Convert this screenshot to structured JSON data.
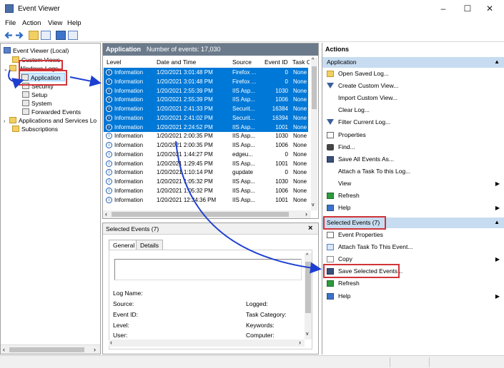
{
  "window": {
    "title": "Event Viewer",
    "minimize": "–",
    "maximize": "☐",
    "close": "✕"
  },
  "menu": [
    "File",
    "Action",
    "View",
    "Help"
  ],
  "tree": {
    "root": "Event Viewer (Local)",
    "custom_views": "Custom Views",
    "windows_logs": "Windows Logs",
    "application": "Application",
    "security": "Security",
    "setup": "Setup",
    "system": "System",
    "forwarded": "Forwarded Events",
    "apps_services": "Applications and Services Lo",
    "subscriptions": "Subscriptions"
  },
  "list": {
    "title": "Application",
    "subtitle": "Number of events: 17,030",
    "columns": [
      "Level",
      "Date and Time",
      "Source",
      "Event ID",
      "Task Ca"
    ],
    "rows": [
      {
        "level": "Information",
        "date": "1/20/2021 3:01:48 PM",
        "source": "Firefox ...",
        "id": "0",
        "task": "None",
        "selected": true
      },
      {
        "level": "Information",
        "date": "1/20/2021 3:01:48 PM",
        "source": "Firefox ...",
        "id": "0",
        "task": "None",
        "selected": true
      },
      {
        "level": "Information",
        "date": "1/20/2021 2:55:39 PM",
        "source": "IIS Asp...",
        "id": "1030",
        "task": "None",
        "selected": true
      },
      {
        "level": "Information",
        "date": "1/20/2021 2:55:39 PM",
        "source": "IIS Asp...",
        "id": "1006",
        "task": "None",
        "selected": true
      },
      {
        "level": "Information",
        "date": "1/20/2021 2:41:33 PM",
        "source": "Securit...",
        "id": "16384",
        "task": "None",
        "selected": true
      },
      {
        "level": "Information",
        "date": "1/20/2021 2:41:02 PM",
        "source": "Securit...",
        "id": "16394",
        "task": "None",
        "selected": true
      },
      {
        "level": "Information",
        "date": "1/20/2021 2:24:52 PM",
        "source": "IIS Asp...",
        "id": "1001",
        "task": "None",
        "selected": true
      },
      {
        "level": "Information",
        "date": "1/20/2021 2:00:35 PM",
        "source": "IIS Asp...",
        "id": "1030",
        "task": "None",
        "selected": false
      },
      {
        "level": "Information",
        "date": "1/20/2021 2:00:35 PM",
        "source": "IIS Asp...",
        "id": "1006",
        "task": "None",
        "selected": false
      },
      {
        "level": "Information",
        "date": "1/20/2021 1:44:27 PM",
        "source": "edgeu...",
        "id": "0",
        "task": "None",
        "selected": false
      },
      {
        "level": "Information",
        "date": "1/20/2021 1:29:45 PM",
        "source": "IIS Asp...",
        "id": "1001",
        "task": "None",
        "selected": false
      },
      {
        "level": "Information",
        "date": "1/20/2021 1:10:14 PM",
        "source": "gupdate",
        "id": "0",
        "task": "None",
        "selected": false
      },
      {
        "level": "Information",
        "date": "1/20/2021 1:05:32 PM",
        "source": "IIS Asp...",
        "id": "1030",
        "task": "None",
        "selected": false
      },
      {
        "level": "Information",
        "date": "1/20/2021 1:05:32 PM",
        "source": "IIS Asp...",
        "id": "1006",
        "task": "None",
        "selected": false
      },
      {
        "level": "Information",
        "date": "1/20/2021 12:34:36 PM",
        "source": "IIS Asp...",
        "id": "1001",
        "task": "None",
        "selected": false
      }
    ]
  },
  "detail": {
    "title": "Selected Events (7)",
    "close": "×",
    "tabs": [
      "General",
      "Details"
    ],
    "fields_left": [
      "Log Name:",
      "Source:",
      "Event ID:",
      "Level:",
      "User:"
    ],
    "fields_right": [
      "Logged:",
      "Task Category:",
      "Keywords:",
      "Computer:"
    ]
  },
  "actions": {
    "header": "Actions",
    "section1": "Application",
    "items1": [
      {
        "label": "Open Saved Log...",
        "icon": "open-folder-icon",
        "submenu": false
      },
      {
        "label": "Create Custom View...",
        "icon": "filter-icon",
        "submenu": false
      },
      {
        "label": "Import Custom View...",
        "icon": "",
        "submenu": false
      },
      {
        "label": "Clear Log...",
        "icon": "",
        "submenu": false
      },
      {
        "label": "Filter Current Log...",
        "icon": "filter-icon",
        "submenu": false
      },
      {
        "label": "Properties",
        "icon": "properties-icon",
        "submenu": false
      },
      {
        "label": "Find...",
        "icon": "binoculars-icon",
        "submenu": false
      },
      {
        "label": "Save All Events As...",
        "icon": "save-icon",
        "submenu": false
      },
      {
        "label": "Attach a Task To this Log...",
        "icon": "",
        "submenu": false
      },
      {
        "label": "View",
        "icon": "",
        "submenu": true
      },
      {
        "label": "Refresh",
        "icon": "refresh-icon",
        "submenu": false
      },
      {
        "label": "Help",
        "icon": "help-icon",
        "submenu": true
      }
    ],
    "section2": "Selected Events (7)",
    "items2": [
      {
        "label": "Event Properties",
        "icon": "properties-icon",
        "submenu": false
      },
      {
        "label": "Attach Task To This Event...",
        "icon": "task-icon",
        "submenu": false
      },
      {
        "label": "Copy",
        "icon": "copy-icon",
        "submenu": true
      },
      {
        "label": "Save Selected Events...",
        "icon": "save-icon",
        "submenu": false
      },
      {
        "label": "Refresh",
        "icon": "refresh-icon",
        "submenu": false
      },
      {
        "label": "Help",
        "icon": "help-icon",
        "submenu": true
      }
    ]
  },
  "colors": {
    "selection": "#0078d7",
    "annotation_red": "#d13438",
    "annotation_blue": "#1d3fd1"
  }
}
